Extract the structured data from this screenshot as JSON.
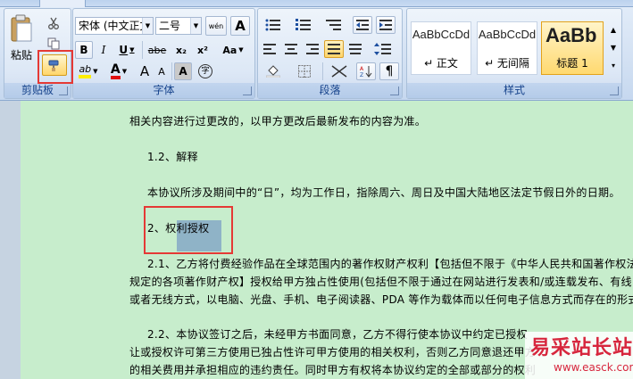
{
  "ribbon": {
    "groups": {
      "clipboard": "剪贴板",
      "font": "字体",
      "paragraph": "段落",
      "styles": "样式"
    },
    "clipboard": {
      "paste_label": "粘贴",
      "cut_icon": "scissors-icon",
      "format_painter_icon": "format-painter-icon"
    },
    "font": {
      "font_name": "宋体 (中文正文)",
      "font_size": "二号",
      "bold": "B",
      "italic": "I",
      "underline": "U",
      "strikethrough": "abe",
      "subscript": "x₂",
      "superscript": "x²",
      "phonetic": "wén",
      "char_border": "A",
      "font_color": "A",
      "grow": "A",
      "shrink": "A",
      "char_shading": "A",
      "enclose": "字",
      "aa": "Aa"
    },
    "styles": {
      "items": [
        {
          "sample": "AaBbCcDd",
          "name": "↵ 正文"
        },
        {
          "sample": "AaBbCcDd",
          "name": "↵ 无间隔"
        },
        {
          "sample": "AaBb",
          "name": "标题 1"
        }
      ]
    }
  },
  "document": {
    "lines": [
      "相关内容进行过更改的，以甲方更改后最新发布的内容为准。",
      "1.2、解释",
      "本协议所涉及期间中的“日”，均为工作日，指除周六、周日及中国大陆地区法定节假日外的日期。",
      "2、权利授权",
      "2.1、乙方将付费经验作品在全球范围内的著作权财产权利【包括但不限于《中华人民共和国著作权法》",
      "规定的各项著作财产权】授权给甲方独占性使用(包括但不限于通过在网站进行发表和/或连载发布、有线",
      "或者无线方式，以电脑、光盘、手机、电子阅读器、PDA 等作为载体而以任何电子信息方式而存在的形式)。",
      "2.2、本协议签订之后，未经甲方书面同意，乙方不得行使本协议中约定已授权",
      "让或授权许可第三方使用已独占性许可甲方使用的相关权利，否则乙方同意退还甲方",
      "的相关费用并承担相应的违约责任。同时甲方有权将本协议约定的全部或部分的权利"
    ],
    "heading_prefix": "2、权",
    "heading_selected": "利授权"
  },
  "watermark": {
    "title": "易采站长站",
    "url": "www.easck.com"
  },
  "colors": {
    "page_bg": "#c7edcc",
    "highlight": "#8fb3c7",
    "annotation_red": "#e53935"
  }
}
